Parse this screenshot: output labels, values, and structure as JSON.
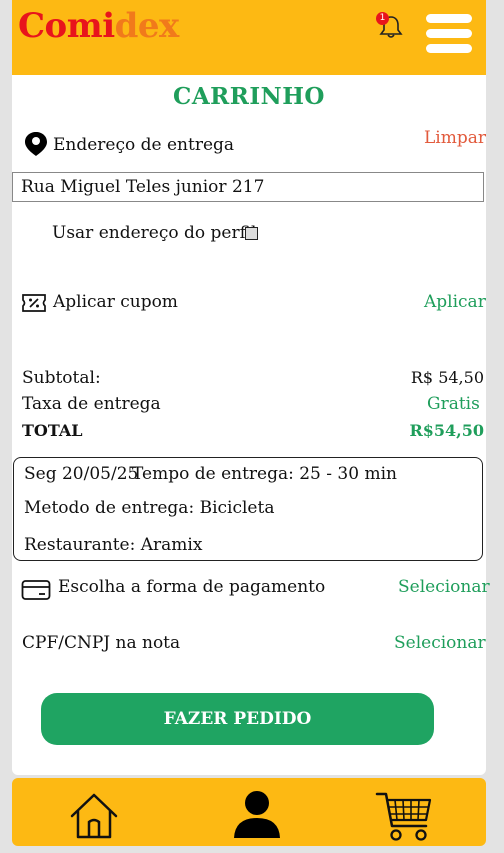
{
  "header": {
    "logo_part1": "Comi",
    "logo_part2": "dex",
    "notification_count": "1"
  },
  "cart": {
    "title": "CARRINHO",
    "delivery_address_label": "Endereço de entrega",
    "clear_label": "Limpar",
    "address_value": "Rua Miguel Teles junior 217",
    "use_profile_address_label": "Usar endereço do perfil",
    "use_profile_address_checked": false,
    "coupon_label": "Aplicar cupom",
    "coupon_action": "Aplicar"
  },
  "summary": {
    "subtotal_label": "Subtotal:",
    "subtotal_value": "R$ 54,50",
    "delivery_fee_label": "Taxa de entrega",
    "delivery_fee_value": "Gratis",
    "total_label": "TOTAL",
    "total_value": "R$54,50"
  },
  "delivery_info": {
    "date": "Seg 20/05/25",
    "time_label": "Tempo de entrega: 25 - 30 min",
    "method": "Metodo de entrega: Bicicleta",
    "restaurant": "Restaurante: Aramix"
  },
  "payment": {
    "label": "Escolha a forma de pagamento",
    "action": "Selecionar"
  },
  "tax_id": {
    "label": "CPF/CNPJ na nota",
    "action": "Selecionar"
  },
  "order_button": "FAZER PEDIDO",
  "colors": {
    "header": "#fdb913",
    "logo_primary": "#e8141c",
    "logo_secondary": "#f17a1b",
    "accent_green": "#1f9e5b",
    "button_green": "#1fa462",
    "clear_red": "#e25a3c"
  },
  "bottom_nav": {
    "items": [
      "home-icon",
      "user-icon",
      "cart-icon"
    ]
  }
}
